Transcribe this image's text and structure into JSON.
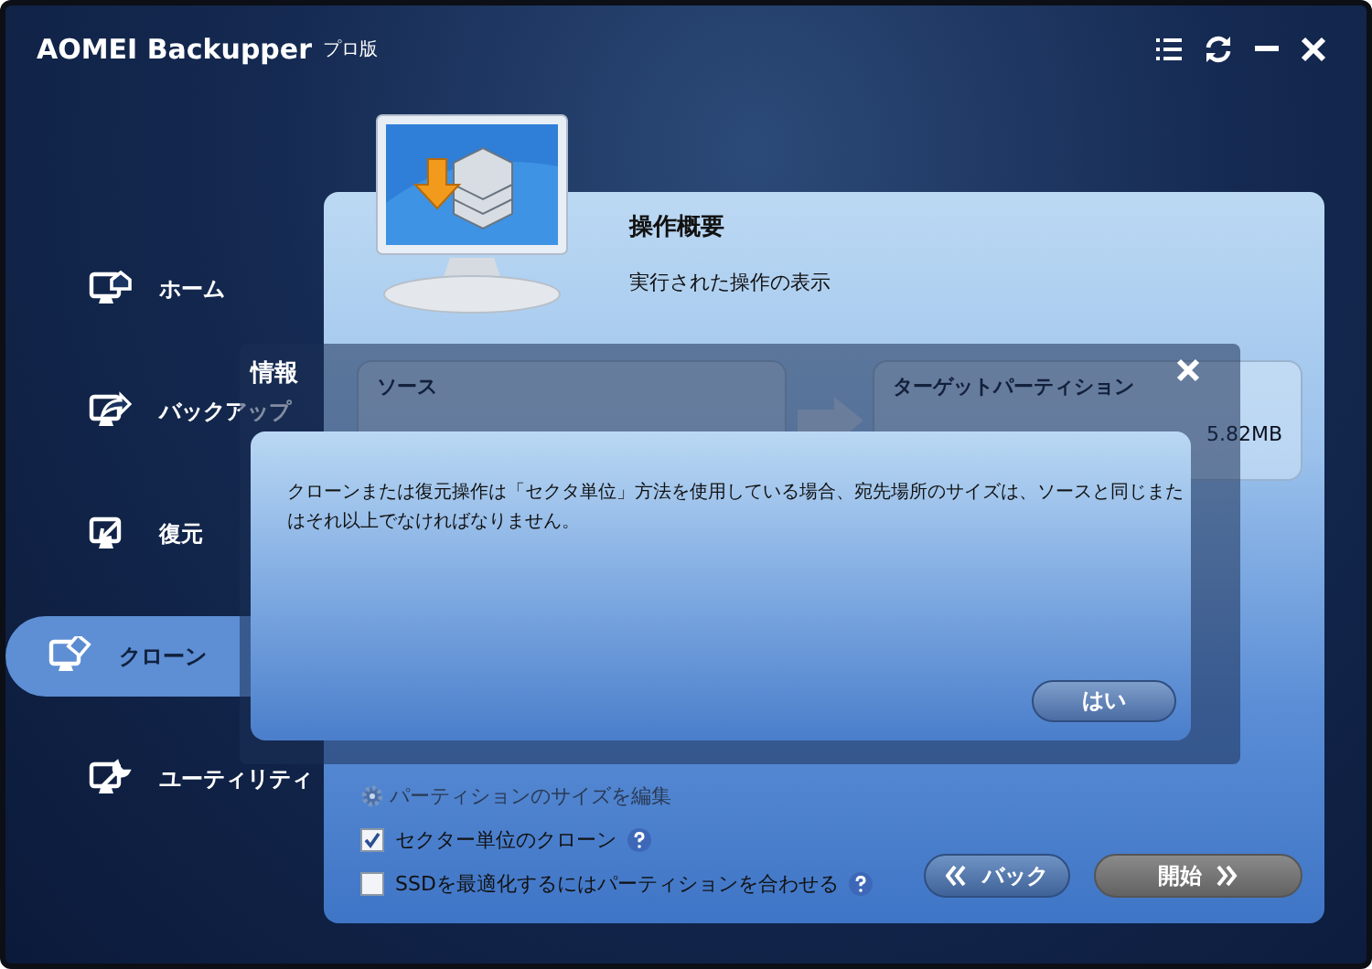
{
  "window": {
    "title": "AOMEI Backupper",
    "edition": "プロ版"
  },
  "sidebar": {
    "items": [
      {
        "label": "ホーム",
        "selected": false
      },
      {
        "label": "バックアップ",
        "selected": false
      },
      {
        "label": "復元",
        "selected": false
      },
      {
        "label": "クローン",
        "selected": true
      },
      {
        "label": "ユーティリティ",
        "selected": false
      }
    ]
  },
  "operation_summary": {
    "title": "操作概要",
    "subtitle": "実行された操作の表示",
    "source": {
      "label": "ソース"
    },
    "target": {
      "label": "ターゲットパーティション",
      "size": "5.82MB"
    },
    "edit_partition_size": "パーティションのサイズを編集",
    "options": [
      {
        "label": "セクター単位のクローン",
        "checked": true
      },
      {
        "label": "SSDを最適化するにはパーティションを合わせる",
        "checked": false
      }
    ]
  },
  "buttons": [
    {
      "label": "バック",
      "kind": "back"
    },
    {
      "label": "開始",
      "kind": "start"
    }
  ],
  "dialog": {
    "title": "情報",
    "message": "クローンまたは復元操作は「セクタ単位」方法を使用している場合、宛先場所のサイズは、ソースと同じまたはそれ以上でなければなりません。",
    "button": "はい"
  }
}
